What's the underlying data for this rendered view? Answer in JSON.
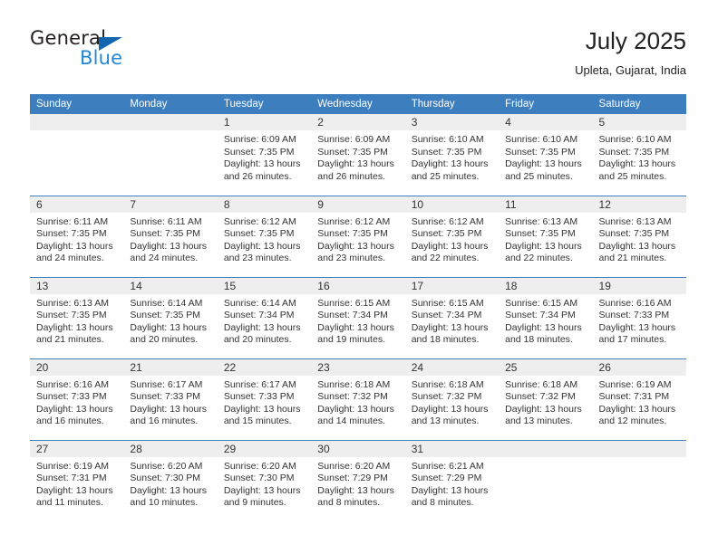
{
  "brand": {
    "name_top": "General",
    "name_bottom": "Blue",
    "accent_color": "#2288d6",
    "triangle_color": "#1266b0"
  },
  "header": {
    "title": "July 2025",
    "subtitle": "Upleta, Gujarat, India"
  },
  "calendar": {
    "header_bg": "#3d7ebf",
    "daynum_bg": "#eeeeee",
    "weekday_headers": [
      "Sunday",
      "Monday",
      "Tuesday",
      "Wednesday",
      "Thursday",
      "Friday",
      "Saturday"
    ],
    "weeks": [
      [
        {
          "day": "",
          "sunrise": "",
          "sunset": "",
          "daylight": ""
        },
        {
          "day": "",
          "sunrise": "",
          "sunset": "",
          "daylight": ""
        },
        {
          "day": "1",
          "sunrise": "Sunrise: 6:09 AM",
          "sunset": "Sunset: 7:35 PM",
          "daylight": "Daylight: 13 hours and 26 minutes."
        },
        {
          "day": "2",
          "sunrise": "Sunrise: 6:09 AM",
          "sunset": "Sunset: 7:35 PM",
          "daylight": "Daylight: 13 hours and 26 minutes."
        },
        {
          "day": "3",
          "sunrise": "Sunrise: 6:10 AM",
          "sunset": "Sunset: 7:35 PM",
          "daylight": "Daylight: 13 hours and 25 minutes."
        },
        {
          "day": "4",
          "sunrise": "Sunrise: 6:10 AM",
          "sunset": "Sunset: 7:35 PM",
          "daylight": "Daylight: 13 hours and 25 minutes."
        },
        {
          "day": "5",
          "sunrise": "Sunrise: 6:10 AM",
          "sunset": "Sunset: 7:35 PM",
          "daylight": "Daylight: 13 hours and 25 minutes."
        }
      ],
      [
        {
          "day": "6",
          "sunrise": "Sunrise: 6:11 AM",
          "sunset": "Sunset: 7:35 PM",
          "daylight": "Daylight: 13 hours and 24 minutes."
        },
        {
          "day": "7",
          "sunrise": "Sunrise: 6:11 AM",
          "sunset": "Sunset: 7:35 PM",
          "daylight": "Daylight: 13 hours and 24 minutes."
        },
        {
          "day": "8",
          "sunrise": "Sunrise: 6:12 AM",
          "sunset": "Sunset: 7:35 PM",
          "daylight": "Daylight: 13 hours and 23 minutes."
        },
        {
          "day": "9",
          "sunrise": "Sunrise: 6:12 AM",
          "sunset": "Sunset: 7:35 PM",
          "daylight": "Daylight: 13 hours and 23 minutes."
        },
        {
          "day": "10",
          "sunrise": "Sunrise: 6:12 AM",
          "sunset": "Sunset: 7:35 PM",
          "daylight": "Daylight: 13 hours and 22 minutes."
        },
        {
          "day": "11",
          "sunrise": "Sunrise: 6:13 AM",
          "sunset": "Sunset: 7:35 PM",
          "daylight": "Daylight: 13 hours and 22 minutes."
        },
        {
          "day": "12",
          "sunrise": "Sunrise: 6:13 AM",
          "sunset": "Sunset: 7:35 PM",
          "daylight": "Daylight: 13 hours and 21 minutes."
        }
      ],
      [
        {
          "day": "13",
          "sunrise": "Sunrise: 6:13 AM",
          "sunset": "Sunset: 7:35 PM",
          "daylight": "Daylight: 13 hours and 21 minutes."
        },
        {
          "day": "14",
          "sunrise": "Sunrise: 6:14 AM",
          "sunset": "Sunset: 7:35 PM",
          "daylight": "Daylight: 13 hours and 20 minutes."
        },
        {
          "day": "15",
          "sunrise": "Sunrise: 6:14 AM",
          "sunset": "Sunset: 7:34 PM",
          "daylight": "Daylight: 13 hours and 20 minutes."
        },
        {
          "day": "16",
          "sunrise": "Sunrise: 6:15 AM",
          "sunset": "Sunset: 7:34 PM",
          "daylight": "Daylight: 13 hours and 19 minutes."
        },
        {
          "day": "17",
          "sunrise": "Sunrise: 6:15 AM",
          "sunset": "Sunset: 7:34 PM",
          "daylight": "Daylight: 13 hours and 18 minutes."
        },
        {
          "day": "18",
          "sunrise": "Sunrise: 6:15 AM",
          "sunset": "Sunset: 7:34 PM",
          "daylight": "Daylight: 13 hours and 18 minutes."
        },
        {
          "day": "19",
          "sunrise": "Sunrise: 6:16 AM",
          "sunset": "Sunset: 7:33 PM",
          "daylight": "Daylight: 13 hours and 17 minutes."
        }
      ],
      [
        {
          "day": "20",
          "sunrise": "Sunrise: 6:16 AM",
          "sunset": "Sunset: 7:33 PM",
          "daylight": "Daylight: 13 hours and 16 minutes."
        },
        {
          "day": "21",
          "sunrise": "Sunrise: 6:17 AM",
          "sunset": "Sunset: 7:33 PM",
          "daylight": "Daylight: 13 hours and 16 minutes."
        },
        {
          "day": "22",
          "sunrise": "Sunrise: 6:17 AM",
          "sunset": "Sunset: 7:33 PM",
          "daylight": "Daylight: 13 hours and 15 minutes."
        },
        {
          "day": "23",
          "sunrise": "Sunrise: 6:18 AM",
          "sunset": "Sunset: 7:32 PM",
          "daylight": "Daylight: 13 hours and 14 minutes."
        },
        {
          "day": "24",
          "sunrise": "Sunrise: 6:18 AM",
          "sunset": "Sunset: 7:32 PM",
          "daylight": "Daylight: 13 hours and 13 minutes."
        },
        {
          "day": "25",
          "sunrise": "Sunrise: 6:18 AM",
          "sunset": "Sunset: 7:32 PM",
          "daylight": "Daylight: 13 hours and 13 minutes."
        },
        {
          "day": "26",
          "sunrise": "Sunrise: 6:19 AM",
          "sunset": "Sunset: 7:31 PM",
          "daylight": "Daylight: 13 hours and 12 minutes."
        }
      ],
      [
        {
          "day": "27",
          "sunrise": "Sunrise: 6:19 AM",
          "sunset": "Sunset: 7:31 PM",
          "daylight": "Daylight: 13 hours and 11 minutes."
        },
        {
          "day": "28",
          "sunrise": "Sunrise: 6:20 AM",
          "sunset": "Sunset: 7:30 PM",
          "daylight": "Daylight: 13 hours and 10 minutes."
        },
        {
          "day": "29",
          "sunrise": "Sunrise: 6:20 AM",
          "sunset": "Sunset: 7:30 PM",
          "daylight": "Daylight: 13 hours and 9 minutes."
        },
        {
          "day": "30",
          "sunrise": "Sunrise: 6:20 AM",
          "sunset": "Sunset: 7:29 PM",
          "daylight": "Daylight: 13 hours and 8 minutes."
        },
        {
          "day": "31",
          "sunrise": "Sunrise: 6:21 AM",
          "sunset": "Sunset: 7:29 PM",
          "daylight": "Daylight: 13 hours and 8 minutes."
        },
        {
          "day": "",
          "sunrise": "",
          "sunset": "",
          "daylight": ""
        },
        {
          "day": "",
          "sunrise": "",
          "sunset": "",
          "daylight": ""
        }
      ]
    ]
  }
}
